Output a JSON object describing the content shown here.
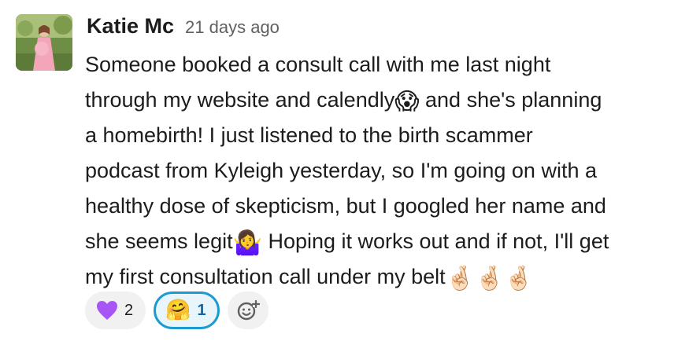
{
  "message": {
    "author": "Katie Mc",
    "timestamp": "21 days ago",
    "lines": [
      {
        "text": "Someone booked a consult call with me last night",
        "emoji": "",
        "after": ""
      },
      {
        "text": "through my website and calendly",
        "emoji": "😱",
        "after": " and she's planning"
      },
      {
        "text": "a homebirth! I just listened to the birth scammer",
        "emoji": "",
        "after": ""
      },
      {
        "text": "podcast from Kyleigh yesterday, so I'm going on with a",
        "emoji": "",
        "after": ""
      },
      {
        "text": "healthy dose of skepticism, but I googled her name and",
        "emoji": "",
        "after": ""
      },
      {
        "text": "she seems legit",
        "emoji": "🤷‍♀️",
        "after": " Hoping it works out and if not, I'll get"
      },
      {
        "text": "my first consultation call under my belt",
        "emoji": "🤞🏻🤞🏻🤞🏻",
        "after": ""
      }
    ]
  },
  "reactions": [
    {
      "emoji": "purple-heart",
      "count": "2",
      "active": false
    },
    {
      "emoji": "🤗",
      "count": "1",
      "active": true
    }
  ],
  "add_reaction_icon": "add-reaction-icon",
  "colors": {
    "accent": "#1d9bd1",
    "heart": "#a855f7",
    "text": "#1d1c1d",
    "muted": "#616061"
  }
}
